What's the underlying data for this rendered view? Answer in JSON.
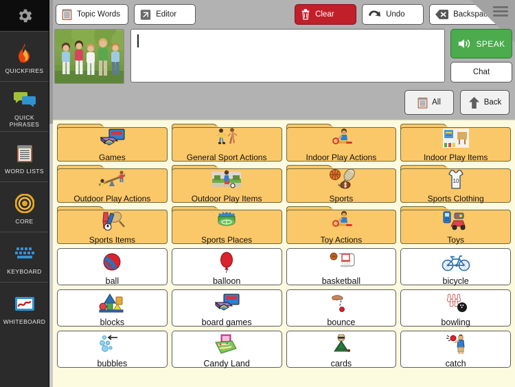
{
  "sidebar": {
    "gear_icon": "gear-icon",
    "items": [
      {
        "label": "QUICKFIRES",
        "icon": "flame-icon"
      },
      {
        "label": "QUICK PHRASES",
        "icon": "speech-bubbles-icon"
      },
      {
        "label": "WORD LISTS",
        "icon": "notepad-icon"
      },
      {
        "label": "CORE",
        "icon": "target-icon"
      },
      {
        "label": "KEYBOARD",
        "icon": "keyboard-icon"
      },
      {
        "label": "WHITEBOARD",
        "icon": "whiteboard-icon"
      }
    ]
  },
  "toolbar": {
    "topic_words_label": "Topic Words",
    "editor_label": "Editor",
    "clear_label": "Clear",
    "undo_label": "Undo",
    "backspace_label": "Backspace",
    "menu_icon": "hamburger-menu-icon",
    "clear_color": "#c0202a"
  },
  "message_bar": {
    "photo_alt": "children-running-photo",
    "text_value": "",
    "placeholder": "",
    "speak_label": "SPEAK",
    "speak_color": "#4bab4d",
    "chat_label": "Chat"
  },
  "nav": {
    "all_label": "All",
    "back_label": "Back"
  },
  "grid": {
    "folder_color": "#fbc869",
    "background_color": "#fcfadf",
    "rows": [
      [
        {
          "label": "Games",
          "type": "folder",
          "icon": "board-game-icon"
        },
        {
          "label": "General Sport Actions",
          "type": "folder",
          "icon": "runners-icon"
        },
        {
          "label": "Indoor Play Actions",
          "type": "folder",
          "icon": "child-playing-icon"
        },
        {
          "label": "Indoor Play Items",
          "type": "folder",
          "icon": "playroom-icon"
        }
      ],
      [
        {
          "label": "Outdoor Play Actions",
          "type": "folder",
          "icon": "seesaw-icon"
        },
        {
          "label": "Outdoor Play Items",
          "type": "folder",
          "icon": "soccer-field-icon"
        },
        {
          "label": "Sports",
          "type": "folder",
          "icon": "sports-balls-icon"
        },
        {
          "label": "Sports Clothing",
          "type": "folder",
          "icon": "jersey-icon"
        }
      ],
      [
        {
          "label": "Sports Items",
          "type": "folder",
          "icon": "sports-gear-icon"
        },
        {
          "label": "Sports Places",
          "type": "folder",
          "icon": "stadium-icon"
        },
        {
          "label": "Toy Actions",
          "type": "folder",
          "icon": "child-playing-icon"
        },
        {
          "label": "Toys",
          "type": "folder",
          "icon": "toys-icon"
        }
      ],
      [
        {
          "label": "ball",
          "type": "plain",
          "icon": "ball-icon"
        },
        {
          "label": "balloon",
          "type": "plain",
          "icon": "balloon-icon"
        },
        {
          "label": "basketball",
          "type": "plain",
          "icon": "basketball-hoop-icon"
        },
        {
          "label": "bicycle",
          "type": "plain",
          "icon": "bicycle-icon"
        }
      ],
      [
        {
          "label": "blocks",
          "type": "plain",
          "icon": "blocks-icon"
        },
        {
          "label": "board games",
          "type": "plain",
          "icon": "board-game-icon"
        },
        {
          "label": "bounce",
          "type": "plain",
          "icon": "bouncing-ball-icon"
        },
        {
          "label": "bowling",
          "type": "plain",
          "icon": "bowling-icon"
        }
      ],
      [
        {
          "label": "bubbles",
          "type": "plain",
          "icon": "bubbles-icon"
        },
        {
          "label": "Candy Land",
          "type": "plain",
          "icon": "candyland-box-icon"
        },
        {
          "label": "cards",
          "type": "plain",
          "icon": "playing-cards-icon"
        },
        {
          "label": "catch",
          "type": "plain",
          "icon": "catch-ball-icon"
        }
      ]
    ]
  }
}
